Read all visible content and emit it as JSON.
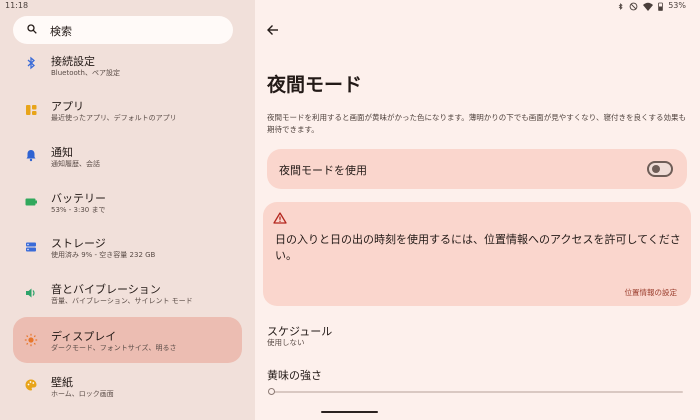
{
  "statusbar": {
    "time": "11:18",
    "battery": "53%",
    "icons": [
      "bluetooth-icon",
      "dnd-icon",
      "wifi-icon",
      "battery-icon"
    ]
  },
  "search": {
    "placeholder": "検索"
  },
  "sidebar": {
    "items": [
      {
        "title": "接続設定",
        "subtitle": "Bluetooth、ペア設定",
        "icon": "bluetooth-icon",
        "color": "#3a6bd8"
      },
      {
        "title": "アプリ",
        "subtitle": "最近使ったアプリ、デフォルトのアプリ",
        "icon": "apps-icon",
        "color": "#e8a419"
      },
      {
        "title": "通知",
        "subtitle": "通知履歴、会話",
        "icon": "bell-icon",
        "color": "#2f63d2"
      },
      {
        "title": "バッテリー",
        "subtitle": "53% - 3:30 まで",
        "icon": "battery-icon",
        "color": "#31a85c"
      },
      {
        "title": "ストレージ",
        "subtitle": "使用済み 9% - 空き容量 232 GB",
        "icon": "storage-icon",
        "color": "#3a6bd8"
      },
      {
        "title": "音とバイブレーション",
        "subtitle": "音量、バイブレーション、サイレント モード",
        "icon": "volume-icon",
        "color": "#2ea36a"
      },
      {
        "title": "ディスプレイ",
        "subtitle": "ダークモード、フォントサイズ、明るさ",
        "icon": "brightness-icon",
        "color": "#e8762a",
        "selected": true
      },
      {
        "title": "壁紙",
        "subtitle": "ホーム、ロック画面",
        "icon": "palette-icon",
        "color": "#e8a419"
      }
    ]
  },
  "main": {
    "title": "夜間モード",
    "description": "夜間モードを利用すると画面が黄味がかった色になります。薄明かりの下でも画面が見やすくなり、寝付きを良くする効果も期待できます。",
    "toggle": {
      "label": "夜間モードを使用",
      "on": false
    },
    "warning": {
      "icon": "warning-icon",
      "text": "日の入りと日の出の時刻を使用するには、位置情報へのアクセスを許可してください。",
      "link": "位置情報の設定"
    },
    "schedule": {
      "title": "スケジュール",
      "value": "使用しない"
    },
    "intensity": {
      "title": "黄味の強さ",
      "level": 0
    }
  }
}
